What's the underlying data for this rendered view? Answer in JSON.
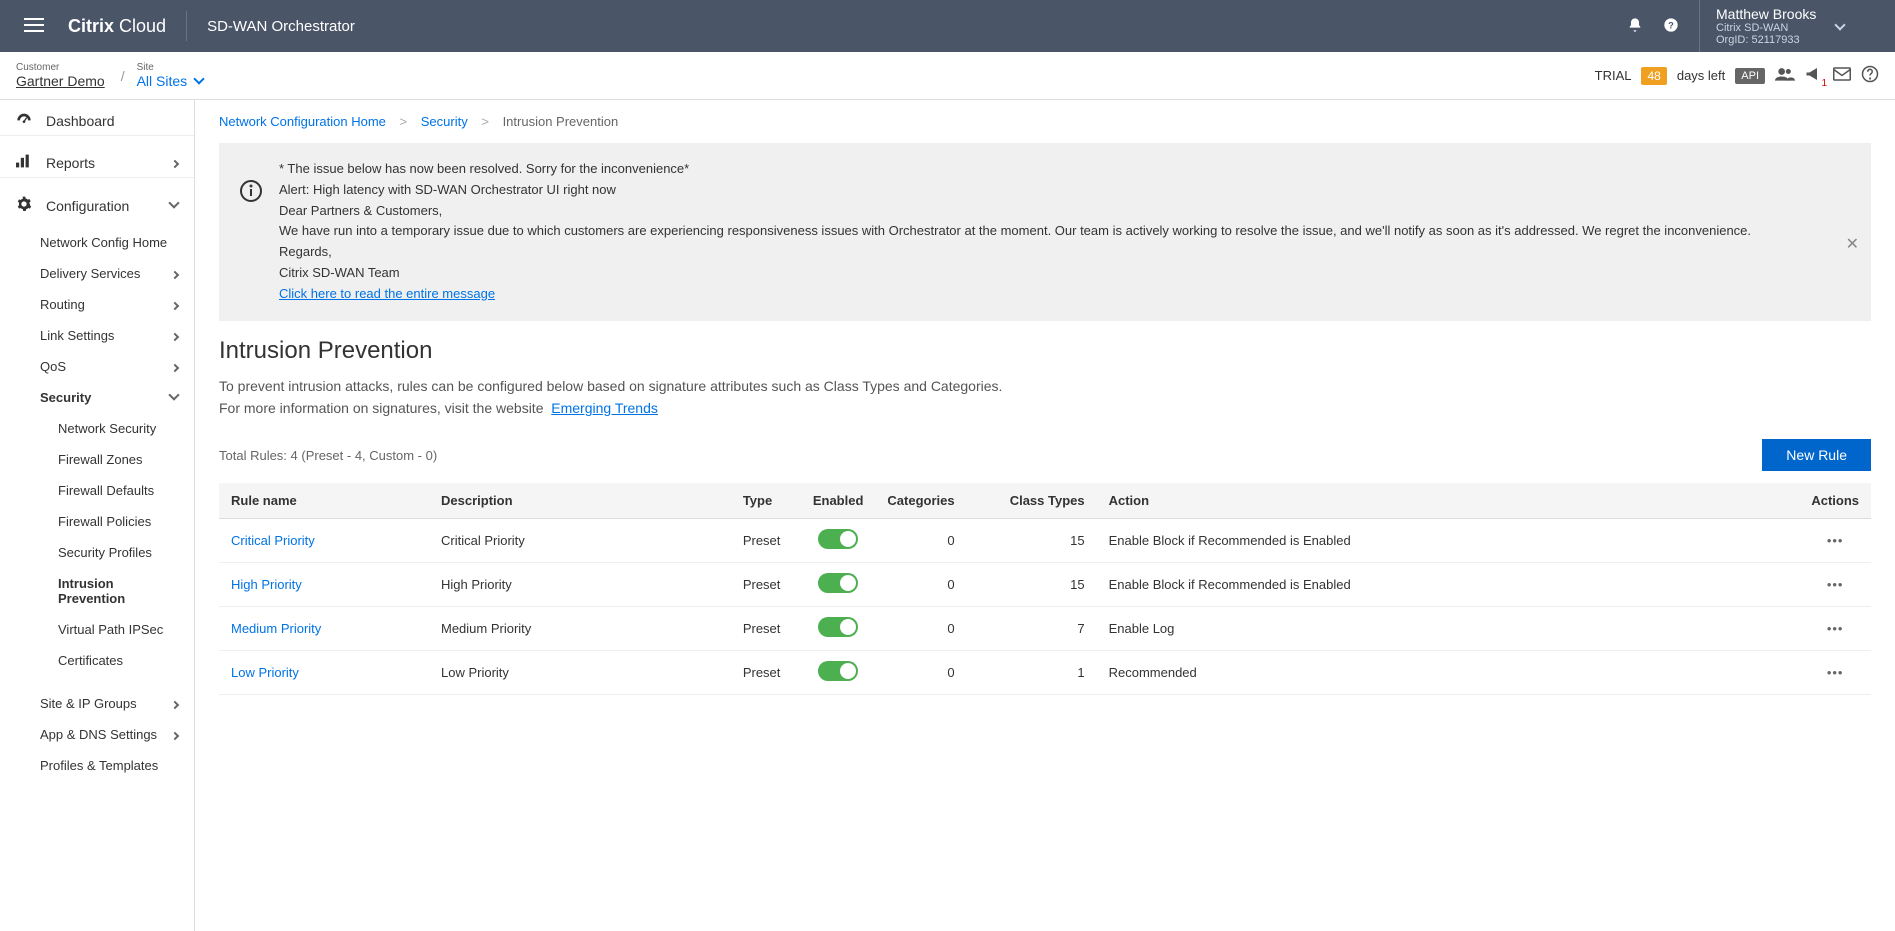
{
  "header": {
    "brand1": "Citrix",
    "brand2": "Cloud",
    "product": "SD-WAN Orchestrator",
    "user_name": "Matthew Brooks",
    "user_product": "Citrix SD-WAN",
    "user_org": "OrgID: 52117933"
  },
  "subheader": {
    "customer_label": "Customer",
    "customer_value": "Gartner Demo",
    "site_label": "Site",
    "site_value": "All Sites",
    "trial_label": "TRIAL",
    "days_badge": "48",
    "days_left": "days left",
    "api_label": "API"
  },
  "sidebar": {
    "dashboard": "Dashboard",
    "reports": "Reports",
    "configuration": "Configuration",
    "config_items": {
      "network_home": "Network Config Home",
      "delivery": "Delivery Services",
      "routing": "Routing",
      "link": "Link Settings",
      "qos": "QoS",
      "security": "Security",
      "site_ip": "Site & IP Groups",
      "app_dns": "App & DNS Settings",
      "profiles": "Profiles & Templates"
    },
    "security_items": {
      "net_sec": "Network Security",
      "fw_zones": "Firewall Zones",
      "fw_defaults": "Firewall Defaults",
      "fw_policies": "Firewall Policies",
      "sec_profiles": "Security Profiles",
      "intrusion": "Intrusion Prevention",
      "vpath": "Virtual Path IPSec",
      "certs": "Certificates"
    }
  },
  "breadcrumbs": {
    "b1": "Network Configuration Home",
    "b2": "Security",
    "b3": "Intrusion Prevention"
  },
  "alert": {
    "l1": "* The issue below has now been resolved. Sorry for the inconvenience*",
    "l2": "Alert: High latency with SD-WAN Orchestrator UI right now",
    "l3": "Dear Partners & Customers,",
    "l4": "We have run into a temporary issue due to which customers are experiencing responsiveness issues with Orchestrator at the moment. Our team is actively working to resolve the issue, and we'll notify as soon as it's addressed. We regret the inconvenience.",
    "l5": "Regards,",
    "l6": "Citrix SD-WAN Team",
    "link": "Click here to read the entire message"
  },
  "page": {
    "title": "Intrusion Prevention",
    "desc1": "To prevent intrusion attacks, rules can be configured below based on signature attributes such as Class Types and Categories.",
    "desc2": "For more information on signatures, visit the website",
    "desc_link": "Emerging Trends",
    "rules_count": "Total Rules: 4 (Preset - 4, Custom - 0)",
    "new_rule": "New Rule"
  },
  "table": {
    "headers": {
      "name": "Rule name",
      "desc": "Description",
      "type": "Type",
      "enabled": "Enabled",
      "categories": "Categories",
      "classtypes": "Class Types",
      "action": "Action",
      "actions": "Actions"
    },
    "rows": [
      {
        "name": "Critical Priority",
        "desc": "Critical Priority",
        "type": "Preset",
        "enabled": true,
        "categories": 0,
        "classtypes": 15,
        "action": "Enable Block if Recommended is Enabled"
      },
      {
        "name": "High Priority",
        "desc": "High Priority",
        "type": "Preset",
        "enabled": true,
        "categories": 0,
        "classtypes": 15,
        "action": "Enable Block if Recommended is Enabled"
      },
      {
        "name": "Medium Priority",
        "desc": "Medium Priority",
        "type": "Preset",
        "enabled": true,
        "categories": 0,
        "classtypes": 7,
        "action": "Enable Log"
      },
      {
        "name": "Low Priority",
        "desc": "Low Priority",
        "type": "Preset",
        "enabled": true,
        "categories": 0,
        "classtypes": 1,
        "action": "Recommended"
      }
    ]
  }
}
